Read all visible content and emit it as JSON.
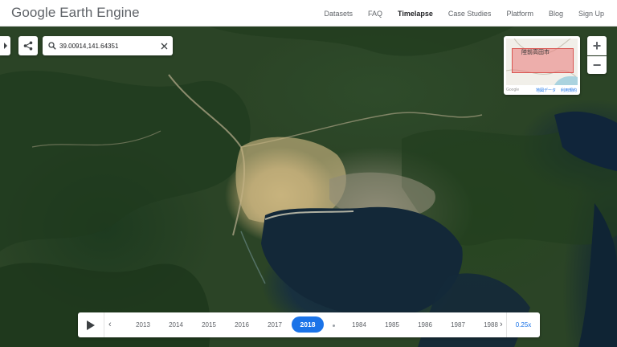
{
  "header": {
    "brand": "Google Earth Engine",
    "nav": [
      {
        "label": "Datasets",
        "active": false
      },
      {
        "label": "FAQ",
        "active": false
      },
      {
        "label": "Timelapse",
        "active": true
      },
      {
        "label": "Case Studies",
        "active": false
      },
      {
        "label": "Platform",
        "active": false
      },
      {
        "label": "Blog",
        "active": false
      },
      {
        "label": "Sign Up",
        "active": false
      }
    ]
  },
  "search": {
    "value": "39.00914,141.64351"
  },
  "minimap": {
    "place_label": "陸前高田市",
    "google": "Google",
    "map_data": "地図データ",
    "terms": "利用規約"
  },
  "zoom": {
    "in": "+",
    "out": "−"
  },
  "timeline": {
    "years": [
      "2013",
      "2014",
      "2015",
      "2016",
      "2017",
      "2018",
      "1984",
      "1985",
      "1986",
      "1987",
      "1988"
    ],
    "active_year": "2018",
    "speed": "0.25x"
  },
  "icons": {
    "collapse": "chevron-right-icon",
    "share": "share-icon",
    "search": "search-icon",
    "clear": "close-icon",
    "play": "play-icon",
    "prev": "chevron-left-icon",
    "next": "chevron-right-icon"
  },
  "colors": {
    "accent": "#1a73e8",
    "header_text": "#5f6368"
  }
}
